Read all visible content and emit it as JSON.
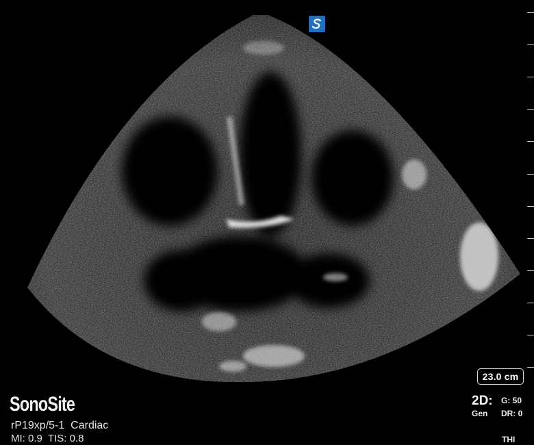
{
  "image": {
    "brand": "SonoSite",
    "probe_preset": "rP19xp/5-1  Cardiac",
    "power": "MI: 0.9  TIS: 0.8",
    "depth": "23.0 cm",
    "mode": "2D:",
    "mode_sub": "Gen",
    "gain": "G: 50",
    "dynamic_range": "DR: 0",
    "thi": "THI",
    "orientation_marker_icon": "sonosite-s-logo-icon",
    "accent_color": "#1f6fc2"
  }
}
